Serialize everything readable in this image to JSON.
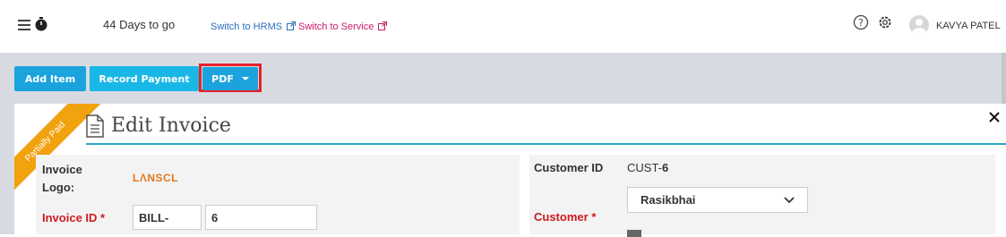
{
  "header": {
    "countdown": "44 Days to go",
    "links": [
      {
        "label": "Switch to HRMS",
        "color": "#2a6ebb"
      },
      {
        "label": "Switch to Service",
        "color": "#d0196b"
      }
    ],
    "user_name": "KAVYA PATEL",
    "icons": [
      "menu-icon",
      "timer-icon",
      "help-icon",
      "gear-icon",
      "avatar"
    ]
  },
  "toolbar": {
    "add_item_label": "Add Item",
    "record_payment_label": "Record Payment",
    "pdf_label": "PDF"
  },
  "invoice": {
    "status_ribbon": "Partially Paid",
    "title": "Edit Invoice",
    "logo_label_line1": "Invoice",
    "logo_label_line2": "Logo:",
    "logo_text": "LΛNSCL",
    "invoice_id_label": "Invoice ID",
    "invoice_id_prefix": "BILL-",
    "invoice_id_number": "6",
    "customer_id_label": "Customer ID",
    "customer_id_prefix": "CUST-",
    "customer_id_number": "6",
    "customer_label": "Customer",
    "customer_value": "Rasikbhai",
    "required_marker": "*"
  },
  "colors": {
    "accent": "#1aa3dd",
    "ribbon": "#f1a20f",
    "highlight_border": "#e8212a",
    "required": "#d01a20"
  }
}
